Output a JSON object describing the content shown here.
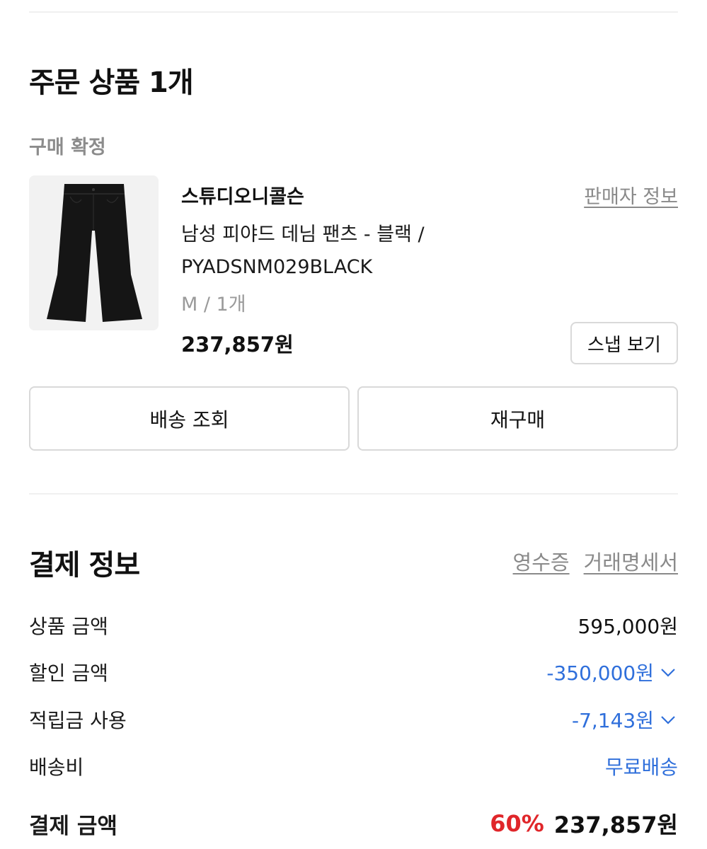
{
  "order": {
    "title": "주문 상품 1개",
    "status": "구매 확정",
    "item": {
      "brand": "스튜디오니콜슨",
      "seller_link": "판매자 정보",
      "name": "남성 피야드 데님 팬츠 - 블랙 / PYADSNM029BLACK",
      "option": "M / 1개",
      "price": "237,857원",
      "snap_button": "스냅 보기",
      "image_icon": "black-wide-pants-image"
    },
    "delivery_button": "배송 조회",
    "reorder_button": "재구매"
  },
  "payment": {
    "title": "결제 정보",
    "receipt_link": "영수증",
    "statement_link": "거래명세서",
    "rows": [
      {
        "label": "상품 금액",
        "value": "595,000원"
      },
      {
        "label": "할인 금액",
        "value": "-350,000원"
      },
      {
        "label": "적립금 사용",
        "value": "-7,143원"
      },
      {
        "label": "배송비",
        "value": "무료배송"
      }
    ],
    "total": {
      "label": "결제 금액",
      "rate": "60%",
      "value": "237,857원"
    }
  },
  "colors": {
    "accent_blue": "#2f6fdb",
    "discount_red": "#e0262a",
    "muted": "#8a8a8a"
  }
}
